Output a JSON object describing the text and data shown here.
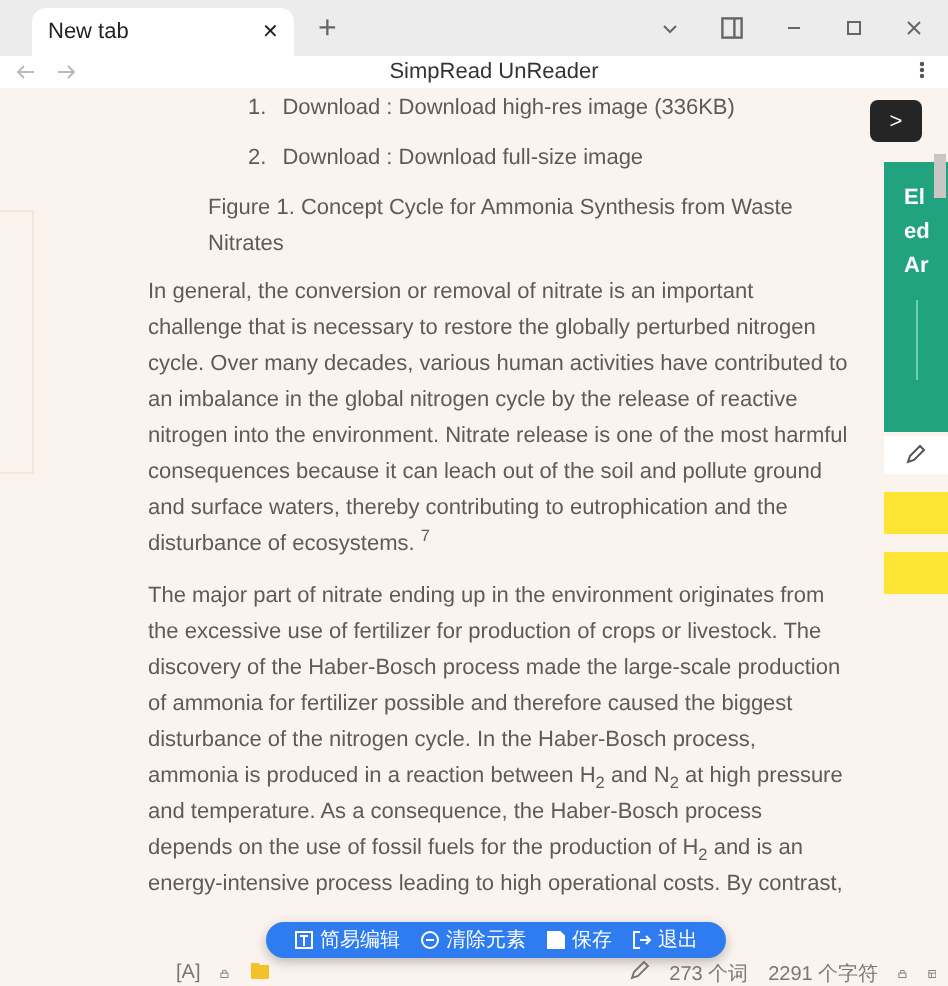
{
  "window": {
    "tab": {
      "title": "New tab",
      "close": "✕",
      "new": "+"
    },
    "title": "SimpRead UnReader"
  },
  "article": {
    "list": [
      {
        "number": "1.",
        "text": "Download : Download high-res image (336KB)"
      },
      {
        "number": "2.",
        "text": "Download : Download full-size image"
      }
    ],
    "caption": "Figure 1. Concept Cycle for Ammonia Synthesis from Waste Nitrates",
    "paragraphs": [
      "In general, the conversion or removal of nitrate is an important challenge that is necessary to restore the globally perturbed nitrogen cycle. Over many decades, various human activities have contributed to an imbalance in the global nitrogen cycle by the release of reactive nitrogen into the environment. Nitrate release is one of the most harmful consequences because it can leach out of the soil and pollute ground and surface waters, thereby contributing to eutrophication and the disturbance of ecosystems. $^{7}$",
      "The major part of nitrate ending up in the environment originates from the excessive use of fertilizer for production of crops or livestock. The discovery of the Haber-Bosch process made the large-scale production of ammonia for fertilizer possible and therefore caused the biggest disturbance of the nitrogen cycle. In the Haber-Bosch process, ammonia is produced in a reaction between H$_{2}$ and N$_{2}$ at high pressure and temperature. As a consequence, the Haber-Bosch process depends on the use of fossil fuels for the production of H$_{2}$ and is an energy-intensive process leading to high operational costs. By contrast,"
    ]
  },
  "side_panel": {
    "toggle": ">",
    "card_lines": [
      "El",
      "ed",
      "Ar"
    ]
  },
  "toolbar": [
    {
      "kind": "edit",
      "label": "简易编辑"
    },
    {
      "kind": "clear",
      "label": "清除元素"
    },
    {
      "kind": "save",
      "label": "保存"
    },
    {
      "kind": "exit",
      "label": "退出"
    }
  ],
  "status_bar": {
    "font_toggle": "[A]",
    "words": "273 个词",
    "chars": "2291 个字符"
  }
}
